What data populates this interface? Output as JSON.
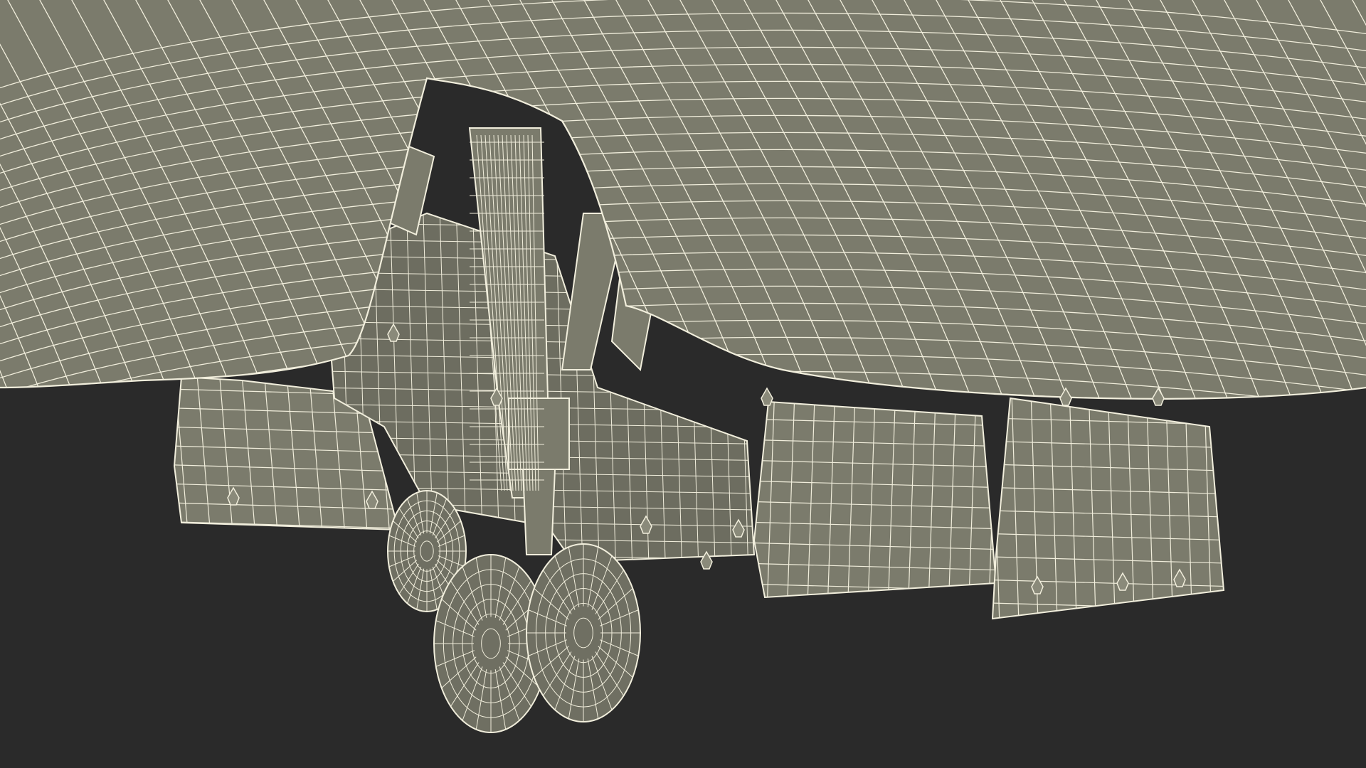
{
  "scene": {
    "subject": "wireframe-render",
    "colors": {
      "background": "#2a2a2a",
      "surface": "#7b7b6c",
      "surface_light": "#8a8a7a",
      "surface_dark": "#5f5f52",
      "wire": "#f1eedc",
      "tire": "#6f6f62"
    }
  }
}
